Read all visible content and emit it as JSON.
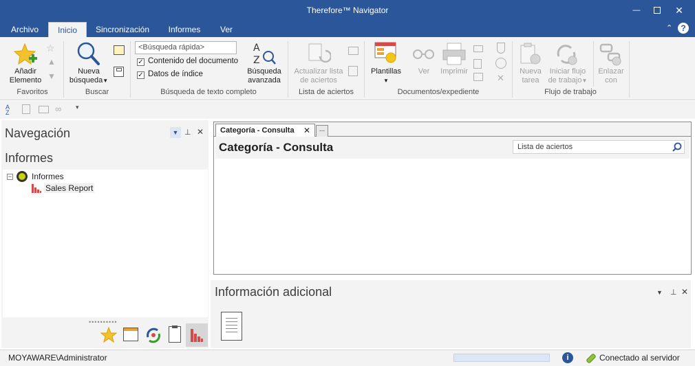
{
  "window": {
    "title": "Therefore™ Navigator",
    "minimize_glyph": "—",
    "maximize_glyph": "☐",
    "close_glyph": "✕"
  },
  "tabs": [
    "Archivo",
    "Inicio",
    "Sincronización",
    "Informes",
    "Ver"
  ],
  "active_tab": "Inicio",
  "ribbon": {
    "groups": {
      "favoritos": "Favoritos",
      "buscar": "Buscar",
      "busqueda_texto": "Búsqueda de texto completo",
      "lista_aciertos": "Lista de aciertos",
      "documentos": "Documentos/expediente",
      "flujo": "Flujo de trabajo"
    },
    "buttons": {
      "anadir_1": "Añadir",
      "anadir_2": "Elemento",
      "nueva_busqueda_1": "Nueva",
      "nueva_busqueda_2": "búsqueda",
      "busqueda_avanzada_1": "Búsqueda",
      "busqueda_avanzada_2": "avanzada",
      "actualizar_1": "Actualizar lista",
      "actualizar_2": "de aciertos",
      "plantillas": "Plantillas",
      "ver": "Ver",
      "imprimir": "Imprimir",
      "nueva_tarea_1": "Nueva",
      "nueva_tarea_2": "tarea",
      "iniciar_flujo_1": "Iniciar flujo",
      "iniciar_flujo_2": "de trabajo",
      "enlazar_1": "Enlazar",
      "enlazar_2": "con"
    },
    "quick_search_placeholder": "<Búsqueda rápida>",
    "checkbox_contenido": "Contenido del documento",
    "checkbox_indice": "Datos de índice",
    "checkbox_contenido_checked": true,
    "checkbox_indice_checked": true
  },
  "navigation": {
    "title": "Navegación",
    "section": "Informes",
    "tree": {
      "root": "Informes",
      "child": "Sales Report"
    }
  },
  "document": {
    "tab_label": "Categoría - Consulta",
    "more_tabs": "...",
    "title": "Categoría - Consulta",
    "hit_search_label": "Lista de aciertos"
  },
  "additional_info": {
    "title": "Información adicional"
  },
  "status": {
    "user": "MOYAWARE\\Administrator",
    "connection": "Conectado al servidor"
  },
  "colors": {
    "accent": "#2b579a",
    "ribbon_bg": "#f3f3f3",
    "chart_icon": "#d84a4a"
  }
}
